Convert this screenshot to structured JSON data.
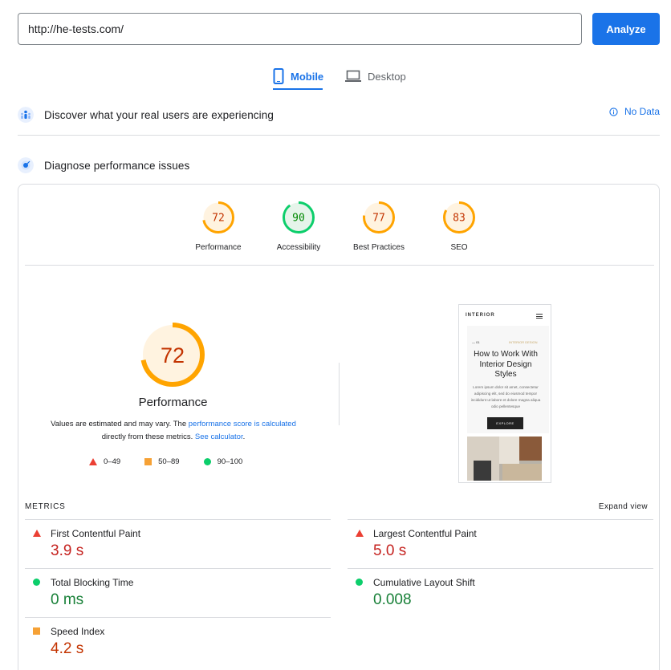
{
  "search": {
    "value": "http://he-tests.com/",
    "button_label": "Analyze"
  },
  "tabs": [
    {
      "label": "Mobile",
      "active": true
    },
    {
      "label": "Desktop",
      "active": false
    }
  ],
  "field_data": {
    "title": "Discover what your real users are experiencing",
    "status": "No Data"
  },
  "lab_data": {
    "title": "Diagnose performance issues"
  },
  "gauges": [
    {
      "label": "Performance",
      "score": "72",
      "score_value": 72,
      "color": "#ffa400",
      "text_color": "#c33300",
      "bg": "#fff3e0"
    },
    {
      "label": "Accessibility",
      "score": "90",
      "score_value": 90,
      "color": "#0cce6b",
      "text_color": "#008800",
      "bg": "#e6f4ea"
    },
    {
      "label": "Best Practices",
      "score": "77",
      "score_value": 77,
      "color": "#ffa400",
      "text_color": "#c33300",
      "bg": "#fff3e0"
    },
    {
      "label": "SEO",
      "score": "83",
      "score_value": 83,
      "color": "#ffa400",
      "text_color": "#c33300",
      "bg": "#fff3e0"
    }
  ],
  "summary": {
    "score": "72",
    "score_value": 72,
    "title": "Performance",
    "note_prefix": "Values are estimated and may vary. The ",
    "note_link1": "performance score is calculated",
    "note_middle": " directly from these metrics. ",
    "note_link2": "See calculator",
    "note_suffix": "."
  },
  "legend": [
    {
      "shape": "triangle",
      "label": "0–49",
      "color": "#eb3f33"
    },
    {
      "shape": "square",
      "label": "50–89",
      "color": "#f6a135"
    },
    {
      "shape": "circle",
      "label": "90–100",
      "color": "#0cce6b"
    }
  ],
  "screenshot": {
    "nav": "INTERIOR",
    "sub_left": "— 01",
    "sub_right": "INTERIOR DESIGN",
    "title": "How to Work With Interior Design Styles",
    "body": "Lorem ipsum dolor sit amet, consectetur adipiscing elit, sed do eiusmod tempor incididunt ut labore et dolore magna aliqua odio pellentesque",
    "button": "EXPLORE"
  },
  "metrics_header": {
    "label": "METRICS",
    "expand": "Expand view"
  },
  "metrics": [
    {
      "name": "First Contentful Paint",
      "value": "3.9 s",
      "status": "fail"
    },
    {
      "name": "Largest Contentful Paint",
      "value": "5.0 s",
      "status": "fail"
    },
    {
      "name": "Total Blocking Time",
      "value": "0 ms",
      "status": "pass"
    },
    {
      "name": "Cumulative Layout Shift",
      "value": "0.008",
      "status": "pass"
    },
    {
      "name": "Speed Index",
      "value": "4.2 s",
      "status": "average"
    }
  ]
}
